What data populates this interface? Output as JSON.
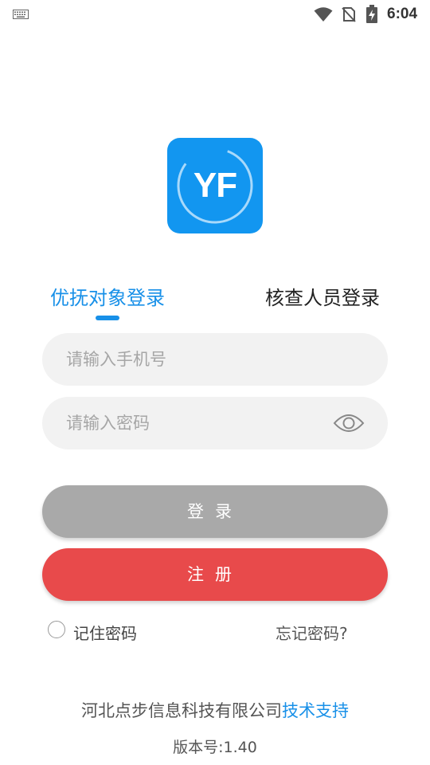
{
  "status_bar": {
    "time": "6:04",
    "icons": [
      "keyboard-icon",
      "wifi-icon",
      "no-sim-icon",
      "battery-charging-icon"
    ]
  },
  "logo": {
    "text": "YF",
    "color": "#1296f0"
  },
  "tabs": [
    {
      "label": "优抚对象登录",
      "active": true
    },
    {
      "label": "核查人员登录",
      "active": false
    }
  ],
  "form": {
    "phone_placeholder": "请输入手机号",
    "phone_value": "",
    "password_placeholder": "请输入密码",
    "password_value": ""
  },
  "buttons": {
    "login_label": "登录",
    "register_label": "注册"
  },
  "options": {
    "remember_label": "记住密码",
    "remember_checked": false,
    "forgot_label": "忘记密码?"
  },
  "footer": {
    "company": "河北点步信息科技有限公司",
    "support_link": "技术支持",
    "version": "版本号:1.40"
  },
  "colors": {
    "accent": "#1890e8",
    "login_button": "#a9a9a9",
    "register_button": "#e84a4b",
    "input_background": "#f2f2f2"
  }
}
